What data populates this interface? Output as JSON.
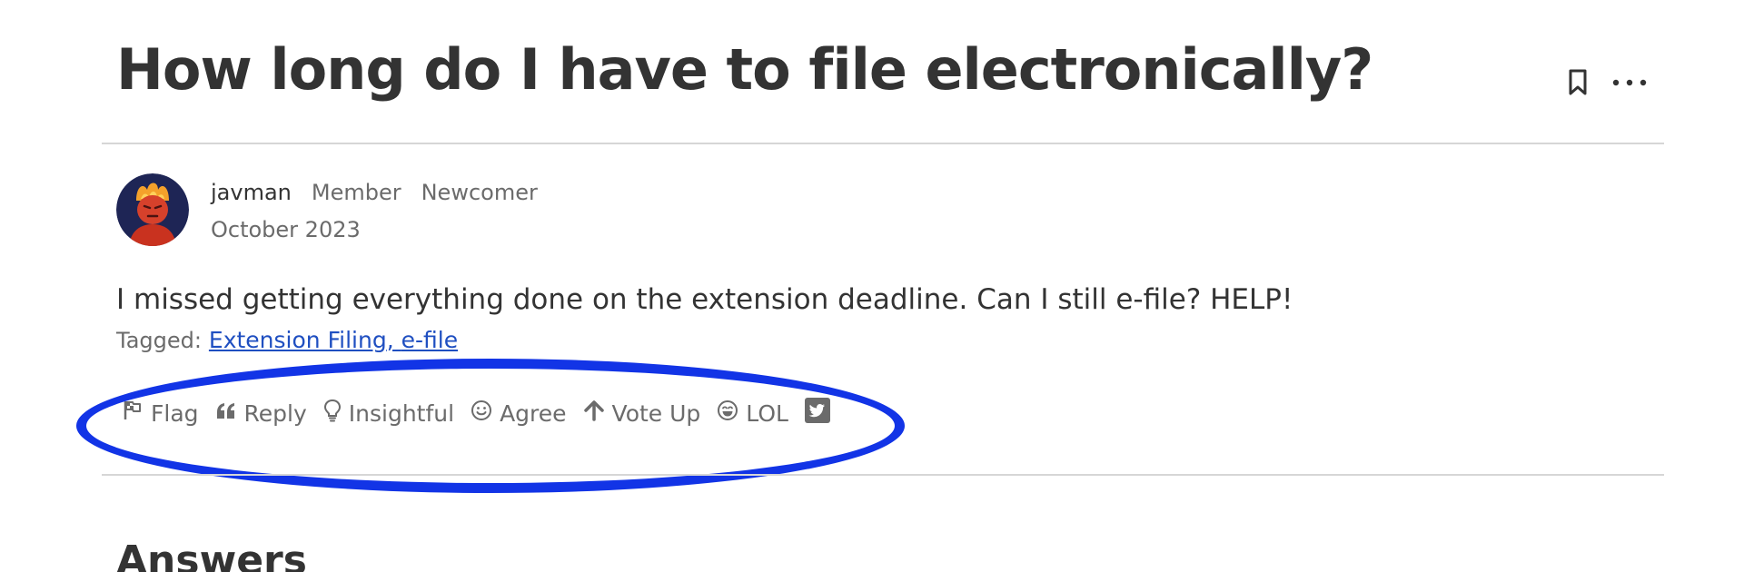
{
  "question": {
    "title": "How long do I have to file electronically?",
    "body": "I missed getting everything done on the extension deadline. Can I still e-file? HELP!"
  },
  "header_actions": {
    "bookmark_icon": "bookmark-icon",
    "more_icon": "more-options-icon"
  },
  "author": {
    "name": "javman",
    "roles": [
      "Member",
      "Newcomer"
    ],
    "date": "October 2023"
  },
  "tags": {
    "label": "Tagged:",
    "items": [
      "Extension Filing",
      "e-file"
    ],
    "separator": ", "
  },
  "reactions": [
    {
      "label": "Flag",
      "icon": "flag-icon"
    },
    {
      "label": "Reply",
      "icon": "quote-icon"
    },
    {
      "label": "Insightful",
      "icon": "lightbulb-icon"
    },
    {
      "label": "Agree",
      "icon": "smile-icon"
    },
    {
      "label": "Vote Up",
      "icon": "arrow-up-icon"
    },
    {
      "label": "LOL",
      "icon": "laugh-icon"
    },
    {
      "label": "",
      "icon": "twitter-icon"
    }
  ],
  "answers_heading": "Answers",
  "colors": {
    "text": "#333333",
    "muted": "#6b6b6b",
    "link": "#1f4fc1",
    "annotation": "#1234e6",
    "divider": "#d6d6d6"
  }
}
